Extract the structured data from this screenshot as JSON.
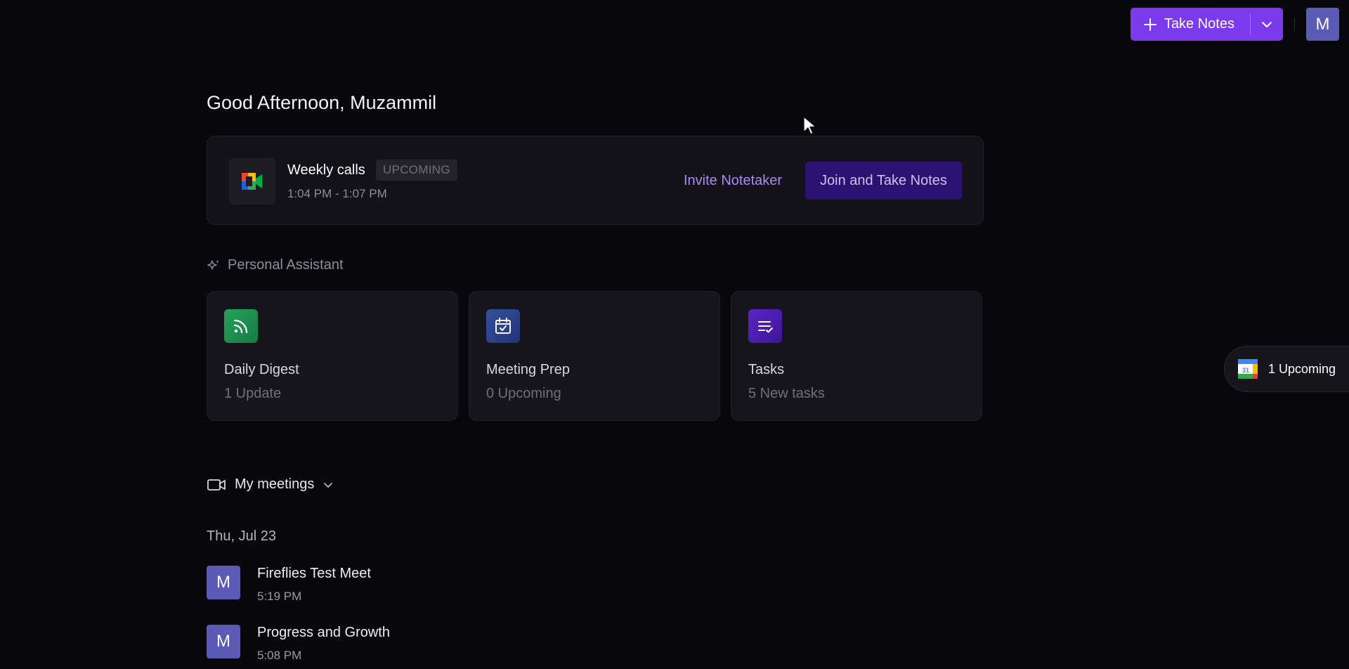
{
  "header": {
    "take_notes_label": "Take Notes",
    "avatar_initial": "M"
  },
  "greeting": "Good Afternoon, Muzammil",
  "upcoming": {
    "title": "Weekly calls",
    "badge": "UPCOMING",
    "time": "1:04 PM - 1:07 PM",
    "invite_label": "Invite Notetaker",
    "join_label": "Join and Take Notes"
  },
  "assistant": {
    "label": "Personal Assistant",
    "cards": [
      {
        "title": "Daily Digest",
        "subtitle": "1 Update",
        "icon": "rss-icon",
        "color": "#1f9d55"
      },
      {
        "title": "Meeting Prep",
        "subtitle": "0 Upcoming",
        "icon": "calendar-check-icon",
        "color": "#2d3f8f"
      },
      {
        "title": "Tasks",
        "subtitle": "5 New tasks",
        "icon": "list-check-icon",
        "color": "#4c1fb0"
      }
    ]
  },
  "meetings": {
    "header_label": "My meetings",
    "date_label": "Thu, Jul 23",
    "items": [
      {
        "initial": "M",
        "title": "Fireflies Test Meet",
        "time": "5:19 PM"
      },
      {
        "initial": "M",
        "title": "Progress and Growth",
        "time": "5:08 PM"
      }
    ]
  },
  "upcoming_pill": {
    "label": "1 Upcoming",
    "calendar_day": "31"
  },
  "colors": {
    "background": "#08080c",
    "accent": "#7c3aed",
    "join_button": "#2b1170",
    "link": "#a58cf0",
    "avatar": "#5b5bb5"
  }
}
